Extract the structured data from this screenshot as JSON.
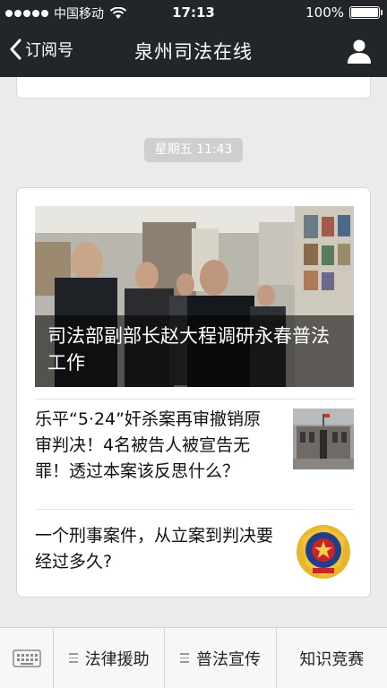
{
  "status_bar": {
    "carrier": "中国移动",
    "time": "17:13",
    "battery": "100%",
    "battery_level": 1.0
  },
  "nav": {
    "back_label": "订阅号",
    "title": "泉州司法在线"
  },
  "timestamp": "星期五 11:43",
  "feed": {
    "cover_title": "司法部副部长赵大程调研永春普法工作",
    "articles": [
      {
        "title": "乐平“5·24”奸杀案再审撤销原审判决！4名被告人被宣告无罪！透过本案该反思什么？",
        "thumb_icon": "courthouse-photo"
      },
      {
        "title": "一个刑事案件，从立案到判决要经过多久?",
        "thumb_icon": "police-emblem"
      }
    ]
  },
  "bottom_menu": {
    "keyboard_icon": "keyboard-icon",
    "items": [
      "法律援助",
      "普法宣传",
      "知识竞赛"
    ]
  },
  "colors": {
    "nav_background": "#22252a",
    "page_background": "#ebebeb"
  }
}
